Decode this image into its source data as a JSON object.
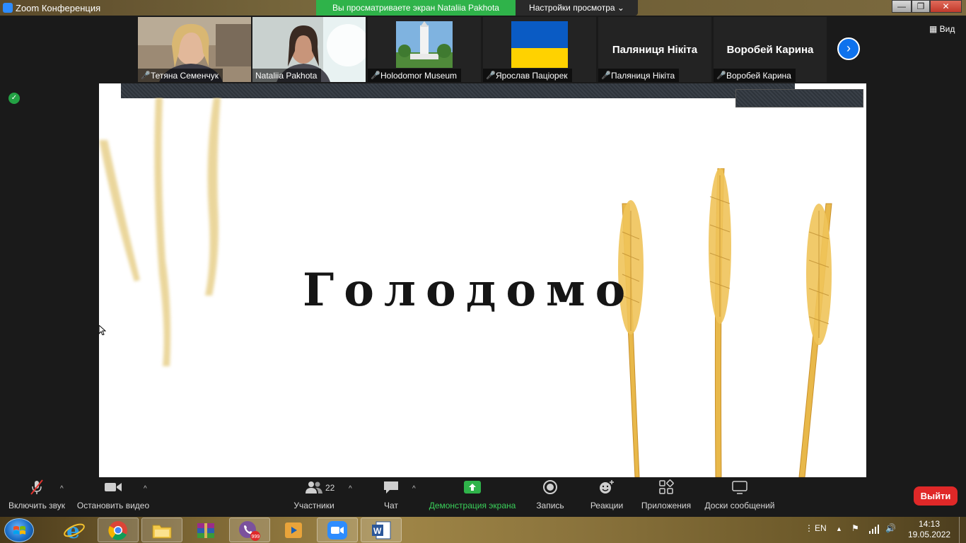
{
  "window": {
    "title": "Zoom Конференция",
    "share_banner": "Вы просматриваете экран Nataliia Pakhota",
    "view_settings": "Настройки просмотра",
    "minimize": "—",
    "maximize": "❐",
    "close": "✕"
  },
  "participants": [
    {
      "name": "Тетяна Семенчук",
      "muted": true,
      "type": "video"
    },
    {
      "name": "Nataliia Pakhota",
      "muted": false,
      "type": "video",
      "active": true
    },
    {
      "name": "Holodomor Museum",
      "muted": true,
      "type": "image"
    },
    {
      "name": "Ярослав Паціорек",
      "muted": true,
      "type": "flag"
    },
    {
      "name": "Паляниця Нікіта",
      "muted": true,
      "type": "name",
      "display": "Паляниця Нікіта"
    },
    {
      "name": "Воробей Карина",
      "muted": true,
      "type": "name",
      "display": "Воробей Карина"
    }
  ],
  "strip": {
    "view_label": "Вид",
    "next_icon": "chevron-right-icon"
  },
  "shared_screen": {
    "slide_title": "Голодомо"
  },
  "toolbar": {
    "unmute_label": "Включить звук",
    "stop_video_label": "Остановить видео",
    "participants_label": "Участники",
    "participants_count": "22",
    "chat_label": "Чат",
    "share_label": "Демонстрация экрана",
    "record_label": "Запись",
    "reactions_label": "Реакции",
    "apps_label": "Приложения",
    "whiteboards_label": "Доски сообщений",
    "leave_label": "Выйти"
  },
  "taskbar": {
    "apps": [
      "start-button",
      "internet-explorer",
      "chrome",
      "file-explorer",
      "winrar",
      "viber",
      "media-player",
      "zoom",
      "word"
    ],
    "viber_badge": "999",
    "language": "EN",
    "time": "14:13",
    "date": "19.05.2022"
  },
  "colors": {
    "accent_green": "#2fb34a",
    "leave_red": "#e02828",
    "zoom_blue": "#0e72ed"
  }
}
